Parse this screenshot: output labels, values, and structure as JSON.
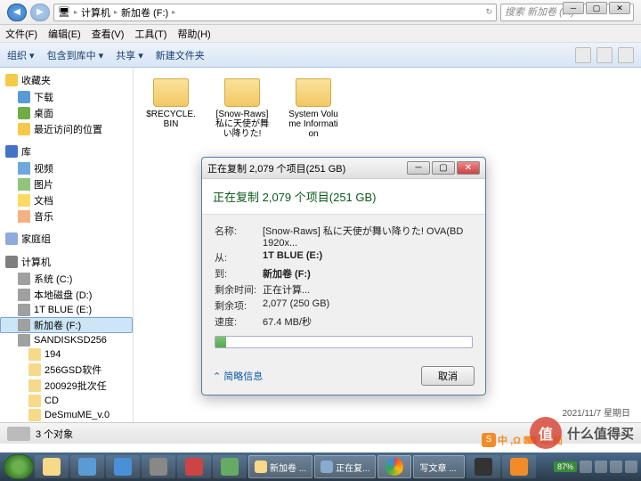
{
  "window_controls": {
    "min": "─",
    "max": "▢",
    "close": "✕"
  },
  "breadcrumb": {
    "root_icon": "🖥",
    "parts": [
      "计算机",
      "新加卷 (F:)"
    ],
    "sep": "▸"
  },
  "search": {
    "placeholder": "搜索 新加卷 (F:)"
  },
  "menu": [
    "文件(F)",
    "编辑(E)",
    "查看(V)",
    "工具(T)",
    "帮助(H)"
  ],
  "toolbar": {
    "items": [
      "组织 ▾",
      "包含到库中 ▾",
      "共享 ▾",
      "新建文件夹"
    ]
  },
  "sidebar": {
    "fav": {
      "head": "收藏夹",
      "items": [
        "下载",
        "桌面",
        "最近访问的位置"
      ]
    },
    "lib": {
      "head": "库",
      "items": [
        "视频",
        "图片",
        "文档",
        "音乐"
      ]
    },
    "home": {
      "head": "家庭组"
    },
    "comp": {
      "head": "计算机",
      "items": [
        "系统 (C:)",
        "本地磁盘 (D:)",
        "1T BLUE (E:)",
        "新加卷 (F:)",
        "SANDISKSD256"
      ],
      "sub": [
        "194",
        "256GSD软件",
        "200929批次任",
        "CD",
        "DeSmuME_v.0"
      ]
    }
  },
  "folders": [
    {
      "name": "$RECYCLE.BIN"
    },
    {
      "name": "[Snow-Raws] 私に天使が舞い降りた!"
    },
    {
      "name": "System Volume Information"
    }
  ],
  "status": {
    "count": "3 个对象"
  },
  "dialog": {
    "title": "正在复制 2,079 个项目(251 GB)",
    "heading": "正在复制 2,079 个项目(251 GB)",
    "rows": {
      "name_l": "名称:",
      "name_v": "[Snow-Raws] 私に天使が舞い降りた! OVA(BD 1920x...",
      "from_l": "从:",
      "from_v": "1T BLUE (E:)",
      "to_l": "到:",
      "to_v": "新加卷 (F:)",
      "time_l": "剩余时间:",
      "time_v": "正在计算...",
      "remain_l": "剩余项:",
      "remain_v": "2,077 (250 GB)",
      "speed_l": "速度:",
      "speed_v": "67.4 MB/秒"
    },
    "more": "简略信息",
    "cancel": "取消"
  },
  "taskbar": {
    "tasks": [
      "新加卷 ...",
      "正在复...",
      "写文章 ..."
    ],
    "battery": "87%"
  },
  "ime": {
    "s": "S",
    "txt": "中 ,Ω ⌨ 双 简 "
  },
  "datestamp": "2021/11/7 星期日",
  "watermark": {
    "char": "值",
    "text": "什么值得买"
  }
}
